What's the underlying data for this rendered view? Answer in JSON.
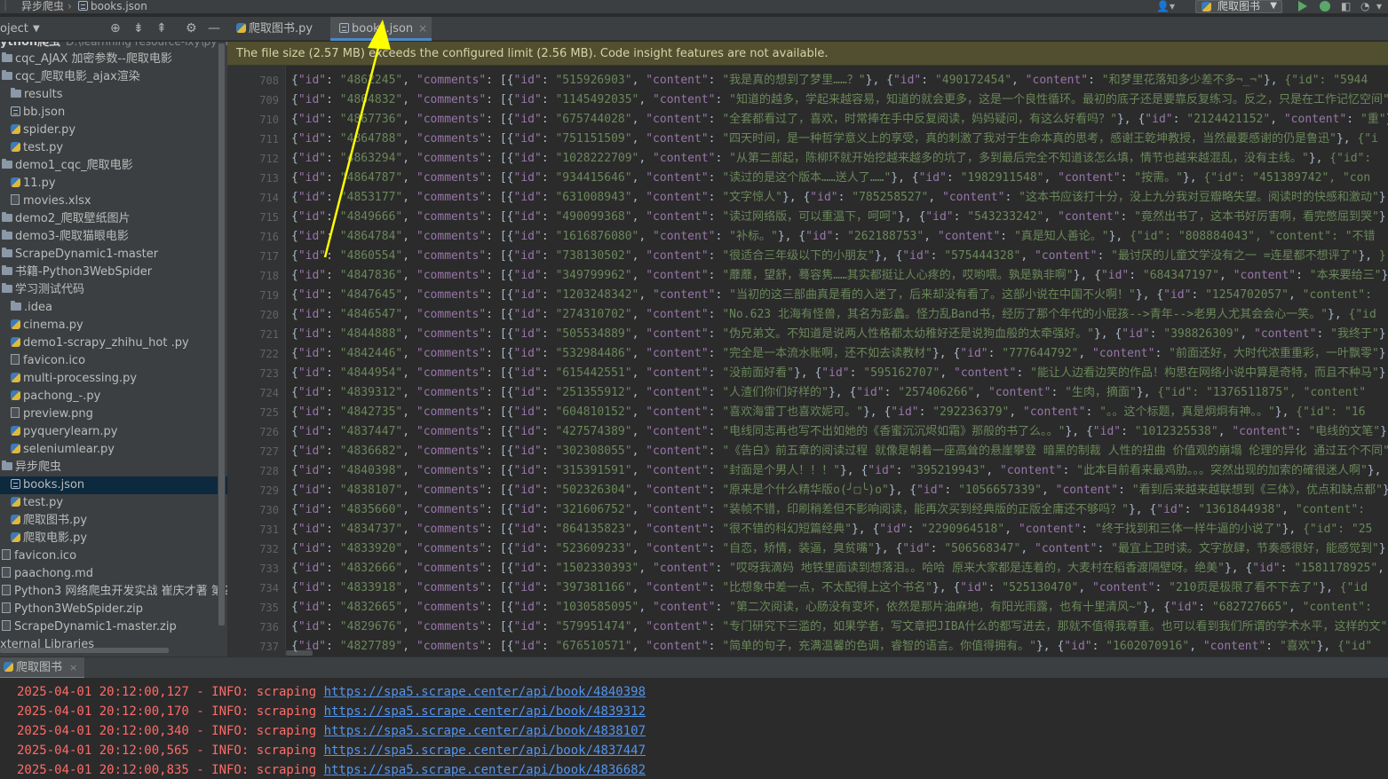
{
  "breadcrumb": {
    "parent": "异步爬虫",
    "file": "books.json"
  },
  "toolbar": {
    "run_config": "爬取图书"
  },
  "project_panel": {
    "title": "oject",
    "items": [
      {
        "label": "ython爬虫",
        "path": "D:\\learnning resource-lxy\\python",
        "type": "root",
        "indent": 0
      },
      {
        "label": "cqc_AJAX 加密参数--爬取电影",
        "type": "folder",
        "indent": 1
      },
      {
        "label": "cqc_爬取电影_ajax渲染",
        "type": "folder",
        "indent": 1
      },
      {
        "label": "results",
        "type": "folder",
        "indent": 2
      },
      {
        "label": "bb.json",
        "type": "json",
        "indent": 2
      },
      {
        "label": "spider.py",
        "type": "py",
        "indent": 2
      },
      {
        "label": "test.py",
        "type": "py",
        "indent": 2
      },
      {
        "label": "demo1_cqc_爬取电影",
        "type": "folder",
        "indent": 1
      },
      {
        "label": "11.py",
        "type": "py",
        "indent": 2
      },
      {
        "label": "movies.xlsx",
        "type": "file",
        "indent": 2
      },
      {
        "label": "demo2_爬取壁纸图片",
        "type": "folder",
        "indent": 1
      },
      {
        "label": "demo3-爬取猫眼电影",
        "type": "folder",
        "indent": 1
      },
      {
        "label": "ScrapeDynamic1-master",
        "type": "folder",
        "indent": 1
      },
      {
        "label": "书籍-Python3WebSpider",
        "type": "folder",
        "indent": 1
      },
      {
        "label": "学习测试代码",
        "type": "folder",
        "indent": 1
      },
      {
        "label": ".idea",
        "type": "folder",
        "indent": 2
      },
      {
        "label": "cinema.py",
        "type": "py",
        "indent": 2
      },
      {
        "label": "demo1-scrapy_zhihu_hot .py",
        "type": "py",
        "indent": 2
      },
      {
        "label": "favicon.ico",
        "type": "file",
        "indent": 2
      },
      {
        "label": "multi-processing.py",
        "type": "py",
        "indent": 2
      },
      {
        "label": "pachong_-.py",
        "type": "py",
        "indent": 2
      },
      {
        "label": "preview.png",
        "type": "file",
        "indent": 2
      },
      {
        "label": "pyquerylearn.py",
        "type": "py",
        "indent": 2
      },
      {
        "label": "seleniumlear.py",
        "type": "py",
        "indent": 2
      },
      {
        "label": "异步爬虫",
        "type": "folder",
        "indent": 1
      },
      {
        "label": "books.json",
        "type": "json",
        "indent": 2,
        "selected": true
      },
      {
        "label": "test.py",
        "type": "py",
        "indent": 2
      },
      {
        "label": "爬取图书.py",
        "type": "py",
        "indent": 2
      },
      {
        "label": "爬取电影.py",
        "type": "py",
        "indent": 2
      },
      {
        "label": "favicon.ico",
        "type": "file",
        "indent": 1
      },
      {
        "label": "paachong.md",
        "type": "file",
        "indent": 1
      },
      {
        "label": "Python3 网络爬虫开发实战 崔庆才著 第2版.p",
        "type": "file",
        "indent": 1
      },
      {
        "label": "Python3WebSpider.zip",
        "type": "file",
        "indent": 1
      },
      {
        "label": "ScrapeDynamic1-master.zip",
        "type": "file",
        "indent": 1
      },
      {
        "label": "xternal Libraries",
        "type": "lib",
        "indent": 0
      }
    ]
  },
  "tabs": [
    {
      "label": "爬取图书.py",
      "icon": "python-file-icon",
      "active": false
    },
    {
      "label": "books.json",
      "icon": "json-file-icon",
      "active": true
    }
  ],
  "warning": "The file size (2.57 MB) exceeds the configured limit (2.56 MB). Code insight features are not available.",
  "editor_lines": [
    {
      "n": "708",
      "id": "4862245",
      "cid": "515926903",
      "text": "我是真的想到了梦里……？",
      "id2": "490172454",
      "text2": "和梦里花落知多少差不多¬_¬",
      "tail": "{\"id\": \"5944"
    },
    {
      "n": "709",
      "id": "4864832",
      "cid": "1145492035",
      "text": "知道的越多，学起来越容易，知道的就会更多，这是一个良性循环。最初的底子还是要靠反复练习。反之，只是在工作记忆空间",
      "id2": "",
      "text2": "",
      "tail": ""
    },
    {
      "n": "710",
      "id": "4867736",
      "cid": "675744028",
      "text": "全套都看过了，喜欢，时常捧在手中反复阅读，妈妈疑问，有这么好看吗？",
      "id2": "2124421152",
      "text2": "重",
      "tail": ""
    },
    {
      "n": "711",
      "id": "4864788",
      "cid": "751151509",
      "text": "四天时间，是一种哲学意义上的享受，真的刺激了我对于生命本真的思考，感谢王乾坤教授，当然最要感谢的仍是鲁迅",
      "id2": "",
      "text2": "",
      "tail": "{\"i"
    },
    {
      "n": "712",
      "id": "4863294",
      "cid": "1028222709",
      "text": "从第二部起，陈柳环就开始挖越来越多的坑了，多到最后完全不知道该怎么填，情节也越来越混乱，没有主线。",
      "id2": "",
      "text2": "",
      "tail": "{\"id\":"
    },
    {
      "n": "713",
      "id": "4864787",
      "cid": "934415646",
      "text": "读过的是这个版本……送人了……",
      "id2": "1982911548",
      "text2": "按需。",
      "tail": "{\"id\": \"451389742\", \"con"
    },
    {
      "n": "714",
      "id": "4853177",
      "cid": "631008943",
      "text": "文字惊人",
      "id2": "785258527",
      "text2": "这本书应该打十分，没上九分我对豆瓣略失望。阅读时的快感和激动",
      "tail": ""
    },
    {
      "n": "715",
      "id": "4849666",
      "cid": "490099368",
      "text": "读过网络版，可以重温下，呵呵",
      "id2": "543233242",
      "text2": "竟然出书了，这本书好厉害啊，看完憋屈到哭",
      "tail": ""
    },
    {
      "n": "716",
      "id": "4864784",
      "cid": "1616876080",
      "text": "补标。",
      "id2": "262188753",
      "text2": "真是知人善论。",
      "tail": "{\"id\": \"808884043\", \"content\": \"不错"
    },
    {
      "n": "717",
      "id": "4860554",
      "cid": "738130502",
      "text": "很适合三年级以下的小朋友",
      "id2": "575444328",
      "text2": "最讨厌的儿童文学没有之一 =连星都不想评了",
      "tail": "}"
    },
    {
      "n": "718",
      "id": "4847836",
      "cid": "349799962",
      "text": "蘼蘼，望舒，蓦容隽……其实都挺让人心疼的，哎哟喂。孰是孰非啊",
      "id2": "684347197",
      "text2": "本来要给三",
      "tail": ""
    },
    {
      "n": "719",
      "id": "4847645",
      "cid": "1203248342",
      "text": "当初的这三部曲真是看的入迷了，后来却没有看了。这部小说在中国不火啊！",
      "id2": "1254702057",
      "text2": "",
      "tail": "\"content\":"
    },
    {
      "n": "720",
      "id": "4846547",
      "cid": "274310702",
      "text": "No.623 北海有怪兽，其名为彭蠡。怪力乱Band书，经历了那个年代的小屁孩-->青年-->老男人尤其会会心一笑。",
      "id2": "",
      "text2": "",
      "tail": "{\"id"
    },
    {
      "n": "721",
      "id": "4844888",
      "cid": "505534889",
      "text": "伪兄弟文。不知道是说两人性格都太幼稚好还是说狗血般的太牵强好。",
      "id2": "398826309",
      "text2": "我终于",
      "tail": ""
    },
    {
      "n": "722",
      "id": "4842446",
      "cid": "532984486",
      "text": "完全是一本流水账啊，还不如去读教材",
      "id2": "777644792",
      "text2": "前面还好，大时代浓重重彩，一叶飘零",
      "tail": ""
    },
    {
      "n": "723",
      "id": "4844954",
      "cid": "615442551",
      "text": "没前面好看",
      "id2": "595162707",
      "text2": "能让人边看边笑的作品！构思在网络小说中算是奇特，而且不种马",
      "tail": ""
    },
    {
      "n": "724",
      "id": "4839312",
      "cid": "251355912",
      "text": "人渣们你们好样的",
      "id2": "257406266",
      "text2": "生肉，摘面",
      "tail": "{\"id\": \"1376511875\", \"content\""
    },
    {
      "n": "725",
      "id": "4842735",
      "cid": "604810152",
      "text": "喜欢海雷丁也喜欢妮可。",
      "id2": "292236379",
      "text2": "。。这个标题，真是炯炯有神。。",
      "tail": "{\"id\": \"16"
    },
    {
      "n": "726",
      "id": "4837447",
      "cid": "427574389",
      "text": "电线同志再也写不出如她的《香蜜沉沉烬如霜》那般的书了么。。",
      "id2": "1012325538",
      "text2": "电线的文笔",
      "tail": ""
    },
    {
      "n": "727",
      "id": "4836682",
      "cid": "302308055",
      "text": "《告白》前五章的阅读过程 就像是朝着一座高耸的悬崖攀登 暗黑的制裁 人性的扭曲 价值观的崩塌 伦理的异化 通过五个不同",
      "id2": "",
      "text2": "",
      "tail": ""
    },
    {
      "n": "728",
      "id": "4840398",
      "cid": "315391591",
      "text": "封面是个男人！！！",
      "id2": "395219943",
      "text2": "此本目前看来最鸡肋。。。突然出现的加索的確很迷人啊",
      "tail": ""
    },
    {
      "n": "729",
      "id": "4838107",
      "cid": "502326304",
      "text": "原来是个什么精华版o(╯□╰)o",
      "id2": "1056657339",
      "text2": "看到后来越来越联想到《三体》，优点和缺点都",
      "tail": ""
    },
    {
      "n": "730",
      "id": "4835660",
      "cid": "321606752",
      "text": "装帧不错，印刷稍差但不影响阅读，能再次买到经典版的正版全庸还不够吗？",
      "id2": "1361844938",
      "text2": "",
      "tail": "\"content\": "
    },
    {
      "n": "731",
      "id": "4834737",
      "cid": "864135823",
      "text": "很不错的科幻短篇经典",
      "id2": "2290964518",
      "text2": "终于找到和三体一样牛逼的小说了",
      "tail": "{\"id\": \"25"
    },
    {
      "n": "732",
      "id": "4833920",
      "cid": "523609233",
      "text": "自恋，矫情，装逼，臭贫嘴",
      "id2": "506568347",
      "text2": "最宜上卫时读。文字放肆，节奏感很好，能感觉到",
      "tail": ""
    },
    {
      "n": "733",
      "id": "4832666",
      "cid": "1502330393",
      "text": "哎呀我滴妈 地铁里面读到想落泪。。哈哈 原来大家都是连着的，大麦村在稻香渡隔壁呀。绝美",
      "id2": "1581178925",
      "text2": "",
      "tail": ""
    },
    {
      "n": "734",
      "id": "4833918",
      "cid": "397381166",
      "text": "比想象中差一点，不太配得上这个书名",
      "id2": "525130470",
      "text2": "210页是极限了看不下去了",
      "tail": "{\"id"
    },
    {
      "n": "735",
      "id": "4832665",
      "cid": "1030585095",
      "text": "第二次阅读，心肠没有变坏，依然是那片油麻地，有阳光雨露，也有十里清风~",
      "id2": "682727665",
      "text2": "",
      "tail": "\"content\":"
    },
    {
      "n": "736",
      "id": "4829676",
      "cid": "579951474",
      "text": "专门研究下三滥的，如果学者，写文章把JIBA什么的都写进去，那就不值得我尊重。也可以看到我们所谓的学术水平，这样的文",
      "id2": "",
      "text2": "",
      "tail": ""
    },
    {
      "n": "737",
      "id": "4827789",
      "cid": "676510571",
      "text": "简单的句子，充满温馨的色调，睿智的语言。你值得拥有。",
      "id2": "1602070916",
      "text2": "喜欢",
      "tail": "{\"id\""
    }
  ],
  "run_panel": {
    "tab_label": "爬取图书",
    "logs": [
      {
        "prefix": "2025-04-01 20:12:00,127 - INFO: scraping ",
        "url": "https://spa5.scrape.center/api/book/4840398"
      },
      {
        "prefix": "2025-04-01 20:12:00,170 - INFO: scraping ",
        "url": "https://spa5.scrape.center/api/book/4839312"
      },
      {
        "prefix": "2025-04-01 20:12:00,340 - INFO: scraping ",
        "url": "https://spa5.scrape.center/api/book/4838107"
      },
      {
        "prefix": "2025-04-01 20:12:00,565 - INFO: scraping ",
        "url": "https://spa5.scrape.center/api/book/4837447"
      },
      {
        "prefix": "2025-04-01 20:12:00,835 - INFO: scraping ",
        "url": "https://spa5.scrape.center/api/book/4836682"
      }
    ]
  },
  "colors": {
    "accent": "#4a88c7",
    "warning_bg": "#514f2f",
    "selection": "#0d293e",
    "log_text": "#ff6b68",
    "link": "#5394ec",
    "annotation_arrow": "#ffff00"
  }
}
